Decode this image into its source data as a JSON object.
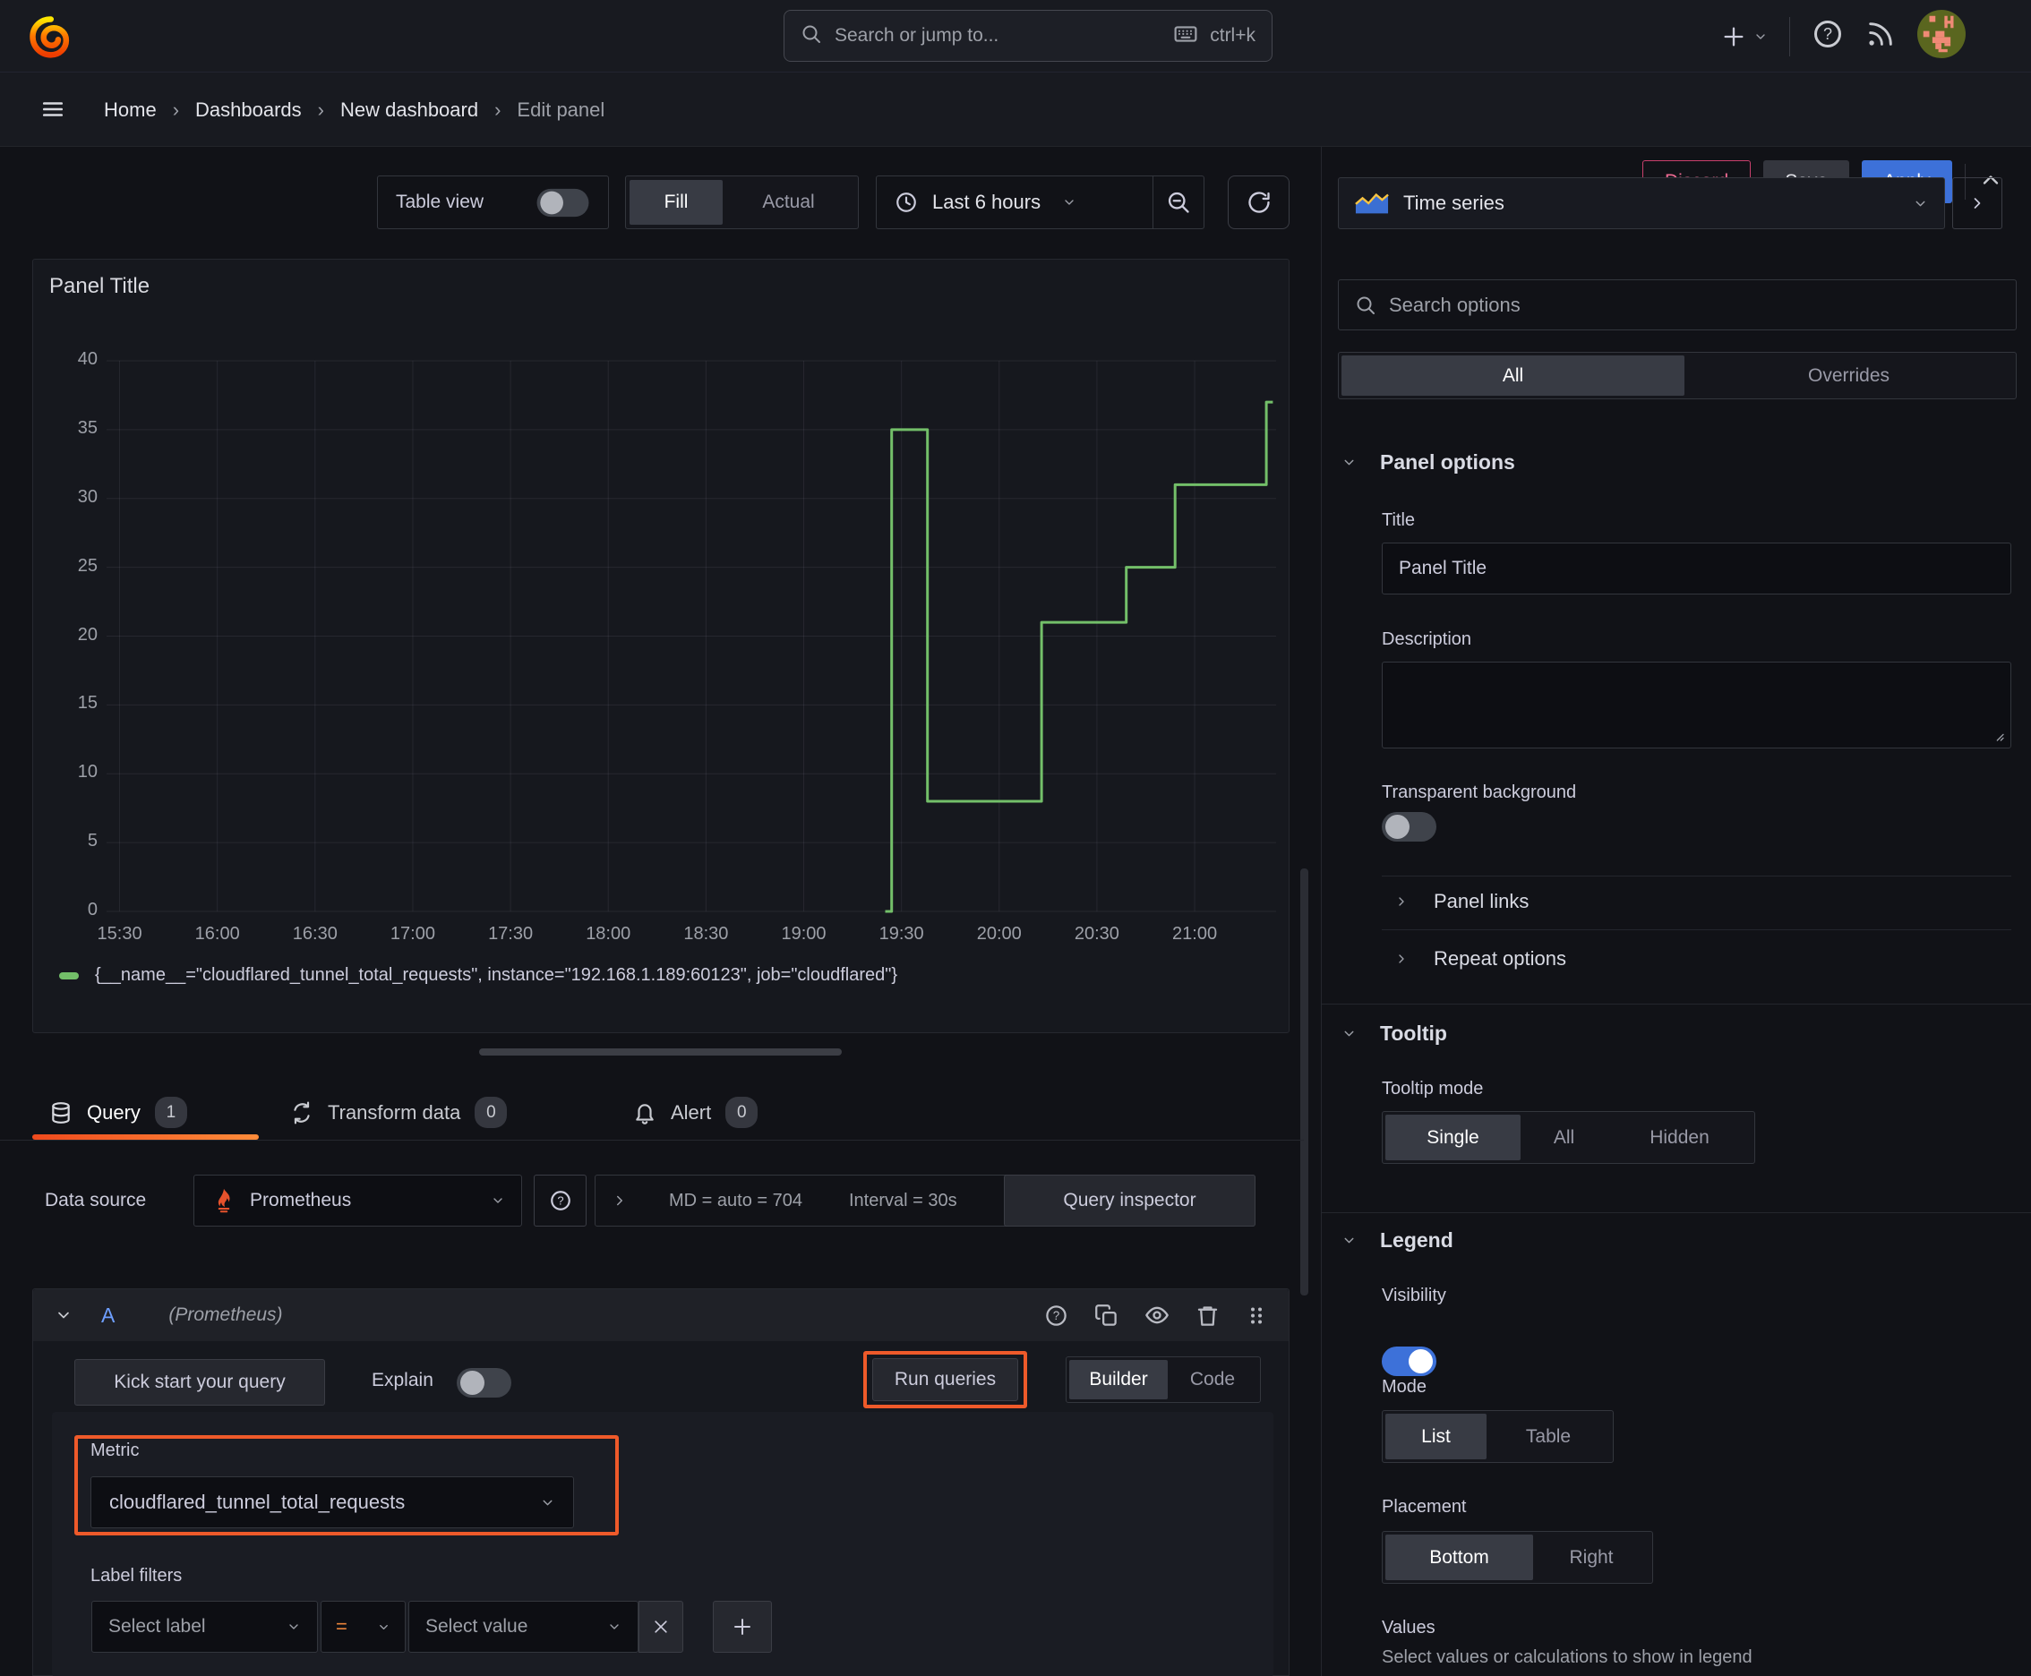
{
  "topbar": {
    "search_placeholder": "Search or jump to...",
    "search_shortcut": "ctrl+k"
  },
  "breadcrumb": {
    "items": [
      "Home",
      "Dashboards",
      "New dashboard"
    ],
    "current": "Edit panel"
  },
  "actions": {
    "discard": "Discard",
    "save": "Save",
    "apply": "Apply"
  },
  "toolbar": {
    "table_view": "Table view",
    "fill": "Fill",
    "actual": "Actual",
    "time_range": "Last 6 hours"
  },
  "panel": {
    "title": "Panel Title"
  },
  "chart_data": {
    "type": "line",
    "line_style": "step-after",
    "title": "Panel Title",
    "grid": true,
    "legend_position": "bottom",
    "ylim": [
      0,
      40
    ],
    "y_ticks": [
      0,
      5,
      10,
      15,
      20,
      25,
      30,
      35,
      40
    ],
    "x_ticks": [
      "15:30",
      "16:00",
      "16:30",
      "17:00",
      "17:30",
      "18:00",
      "18:30",
      "19:00",
      "19:30",
      "20:00",
      "20:30",
      "21:00"
    ],
    "x_domain_minutes": [
      926,
      1285
    ],
    "series": [
      {
        "name": "{__name__=\"cloudflared_tunnel_total_requests\", instance=\"192.168.1.189:60123\", job=\"cloudflared\"}",
        "color": "#73BF69",
        "points": [
          [
            "19:25",
            0
          ],
          [
            "19:27",
            35
          ],
          [
            "19:38",
            8
          ],
          [
            "20:13",
            21
          ],
          [
            "20:39",
            25
          ],
          [
            "20:54",
            31
          ],
          [
            "21:22",
            37
          ]
        ],
        "end_time": "21:24"
      }
    ]
  },
  "tabs": {
    "query": "Query",
    "query_count": "1",
    "transform": "Transform data",
    "transform_count": "0",
    "alert": "Alert",
    "alert_count": "0"
  },
  "datasource": {
    "label": "Data source",
    "name": "Prometheus",
    "stats_md": "MD = auto = 704",
    "stats_interval": "Interval = 30s",
    "inspector": "Query inspector"
  },
  "query": {
    "ref_id": "A",
    "ds_hint": "(Prometheus)",
    "kick_start": "Kick start your query",
    "explain": "Explain",
    "run_queries": "Run queries",
    "builder": "Builder",
    "code": "Code",
    "metric_label": "Metric",
    "metric_value": "cloudflared_tunnel_total_requests",
    "label_filters": "Label filters",
    "select_label": "Select label",
    "operator": "=",
    "select_value": "Select value"
  },
  "sidebar": {
    "viz_name": "Time series",
    "search_placeholder": "Search options",
    "filter_all": "All",
    "filter_overrides": "Overrides",
    "panel_options": {
      "title": "Panel options",
      "title_label": "Title",
      "title_value": "Panel Title",
      "description_label": "Description",
      "transparent_label": "Transparent background"
    },
    "links": "Panel links",
    "repeat": "Repeat options",
    "tooltip": {
      "title": "Tooltip",
      "mode_label": "Tooltip mode",
      "single": "Single",
      "all": "All",
      "hidden": "Hidden"
    },
    "legend": {
      "title": "Legend",
      "visibility_label": "Visibility",
      "mode_label": "Mode",
      "list": "List",
      "table": "Table",
      "placement_label": "Placement",
      "bottom": "Bottom",
      "right": "Right",
      "values_label": "Values",
      "values_hint": "Select values or calculations to show in legend"
    }
  },
  "colors": {
    "accent_orange": "#ee5a2a",
    "green": "#73BF69",
    "blue": "#3d71d9",
    "pink": "#e85b87"
  }
}
